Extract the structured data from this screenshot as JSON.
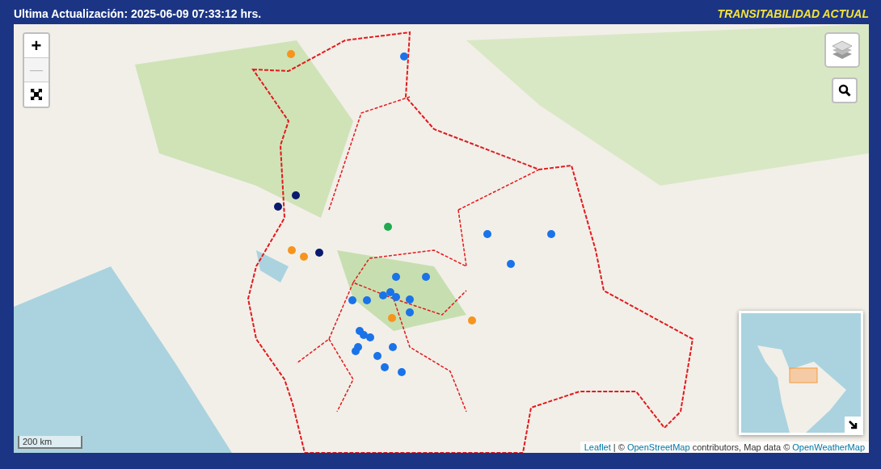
{
  "header": {
    "title": "Ultima Actualización: 2025-06-09 07:33:12 hrs.",
    "subtitle": "TRANSITABILIDAD ACTUAL"
  },
  "zoom_controls": [
    {
      "kind": "zoom-in",
      "label": "+",
      "disabled": false
    },
    {
      "kind": "zoom-out",
      "label": "—",
      "disabled": true
    },
    {
      "kind": "fullscreen",
      "disabled": false
    }
  ],
  "scale": "200 km",
  "attribution": [
    {
      "text": "Leaflet",
      "link": true
    },
    {
      "text": " | © ",
      "link": false
    },
    {
      "text": "OpenStreetMap",
      "link": true
    },
    {
      "text": " contributors, Map data © ",
      "link": false
    },
    {
      "text": "OpenWeatherMap",
      "link": true
    }
  ]
}
